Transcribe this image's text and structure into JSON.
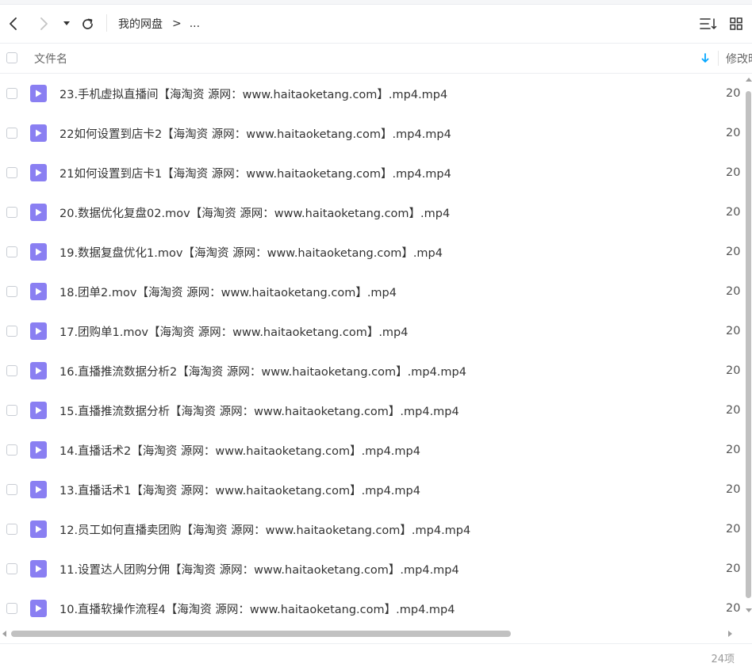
{
  "toolbar": {
    "breadcrumb_root": "我的网盘",
    "breadcrumb_sep": ">",
    "breadcrumb_more": "...",
    "icons": [
      "back-icon",
      "forward-icon",
      "dropdown-icon",
      "refresh-icon",
      "sort-icon",
      "grid-view-icon"
    ]
  },
  "header": {
    "name_label": "文件名",
    "modified_label": "修改时"
  },
  "files": [
    {
      "name": "23.手机虚拟直播间【海淘资 源网：www.haitaoketang.com】.mp4.mp4",
      "date": "20"
    },
    {
      "name": "22如何设置到店卡2【海淘资 源网：www.haitaoketang.com】.mp4.mp4",
      "date": "20"
    },
    {
      "name": "21如何设置到店卡1【海淘资 源网：www.haitaoketang.com】.mp4.mp4",
      "date": "20"
    },
    {
      "name": "20.数据优化复盘02.mov【海淘资 源网：www.haitaoketang.com】.mp4",
      "date": "20"
    },
    {
      "name": "19.数据复盘优化1.mov【海淘资 源网：www.haitaoketang.com】.mp4",
      "date": "20"
    },
    {
      "name": "18.团单2.mov【海淘资 源网：www.haitaoketang.com】.mp4",
      "date": "20"
    },
    {
      "name": "17.团购单1.mov【海淘资 源网：www.haitaoketang.com】.mp4",
      "date": "20"
    },
    {
      "name": "16.直播推流数据分析2【海淘资 源网：www.haitaoketang.com】.mp4.mp4",
      "date": "20"
    },
    {
      "name": "15.直播推流数据分析【海淘资 源网：www.haitaoketang.com】.mp4.mp4",
      "date": "20"
    },
    {
      "name": "14.直播话术2【海淘资 源网：www.haitaoketang.com】.mp4.mp4",
      "date": "20"
    },
    {
      "name": "13.直播话术1【海淘资 源网：www.haitaoketang.com】.mp4.mp4",
      "date": "20"
    },
    {
      "name": "12.员工如何直播卖团购【海淘资 源网：www.haitaoketang.com】.mp4.mp4",
      "date": "20"
    },
    {
      "name": "11.设置达人团购分佣【海淘资 源网：www.haitaoketang.com】.mp4.mp4",
      "date": "20"
    },
    {
      "name": "10.直播软操作流程4【海淘资 源网：www.haitaoketang.com】.mp4.mp4",
      "date": "20"
    }
  ],
  "footer": {
    "count": "24项"
  },
  "colors": {
    "accent": "#06a7ff",
    "video_icon": "#8a7ff2"
  }
}
